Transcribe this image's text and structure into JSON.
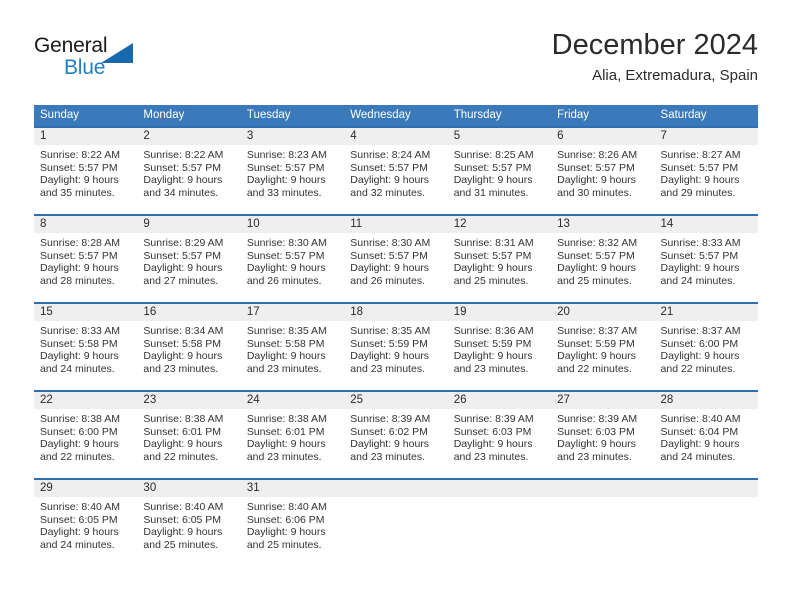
{
  "brand": {
    "name_part1": "General",
    "name_part2": "Blue",
    "triangle_icon": "triangle-icon",
    "accent_color": "#1f7fc4"
  },
  "header": {
    "title": "December 2024",
    "subtitle": "Alia, Extremadura, Spain"
  },
  "colors": {
    "header_blue": "#3a79ba",
    "row_divider_blue": "#2f6eb0",
    "daynum_band": "#efefef",
    "text": "#2b2b2b"
  },
  "calendar": {
    "weekday_headers": [
      "Sunday",
      "Monday",
      "Tuesday",
      "Wednesday",
      "Thursday",
      "Friday",
      "Saturday"
    ],
    "labels": {
      "sunrise_prefix": "Sunrise:",
      "sunset_prefix": "Sunset:",
      "daylight_prefix": "Daylight:"
    },
    "weeks": [
      [
        {
          "day": "1",
          "sunrise": "Sunrise: 8:22 AM",
          "sunset": "Sunset: 5:57 PM",
          "daylight_1": "Daylight: 9 hours",
          "daylight_2": "and 35 minutes."
        },
        {
          "day": "2",
          "sunrise": "Sunrise: 8:22 AM",
          "sunset": "Sunset: 5:57 PM",
          "daylight_1": "Daylight: 9 hours",
          "daylight_2": "and 34 minutes."
        },
        {
          "day": "3",
          "sunrise": "Sunrise: 8:23 AM",
          "sunset": "Sunset: 5:57 PM",
          "daylight_1": "Daylight: 9 hours",
          "daylight_2": "and 33 minutes."
        },
        {
          "day": "4",
          "sunrise": "Sunrise: 8:24 AM",
          "sunset": "Sunset: 5:57 PM",
          "daylight_1": "Daylight: 9 hours",
          "daylight_2": "and 32 minutes."
        },
        {
          "day": "5",
          "sunrise": "Sunrise: 8:25 AM",
          "sunset": "Sunset: 5:57 PM",
          "daylight_1": "Daylight: 9 hours",
          "daylight_2": "and 31 minutes."
        },
        {
          "day": "6",
          "sunrise": "Sunrise: 8:26 AM",
          "sunset": "Sunset: 5:57 PM",
          "daylight_1": "Daylight: 9 hours",
          "daylight_2": "and 30 minutes."
        },
        {
          "day": "7",
          "sunrise": "Sunrise: 8:27 AM",
          "sunset": "Sunset: 5:57 PM",
          "daylight_1": "Daylight: 9 hours",
          "daylight_2": "and 29 minutes."
        }
      ],
      [
        {
          "day": "8",
          "sunrise": "Sunrise: 8:28 AM",
          "sunset": "Sunset: 5:57 PM",
          "daylight_1": "Daylight: 9 hours",
          "daylight_2": "and 28 minutes."
        },
        {
          "day": "9",
          "sunrise": "Sunrise: 8:29 AM",
          "sunset": "Sunset: 5:57 PM",
          "daylight_1": "Daylight: 9 hours",
          "daylight_2": "and 27 minutes."
        },
        {
          "day": "10",
          "sunrise": "Sunrise: 8:30 AM",
          "sunset": "Sunset: 5:57 PM",
          "daylight_1": "Daylight: 9 hours",
          "daylight_2": "and 26 minutes."
        },
        {
          "day": "11",
          "sunrise": "Sunrise: 8:30 AM",
          "sunset": "Sunset: 5:57 PM",
          "daylight_1": "Daylight: 9 hours",
          "daylight_2": "and 26 minutes."
        },
        {
          "day": "12",
          "sunrise": "Sunrise: 8:31 AM",
          "sunset": "Sunset: 5:57 PM",
          "daylight_1": "Daylight: 9 hours",
          "daylight_2": "and 25 minutes."
        },
        {
          "day": "13",
          "sunrise": "Sunrise: 8:32 AM",
          "sunset": "Sunset: 5:57 PM",
          "daylight_1": "Daylight: 9 hours",
          "daylight_2": "and 25 minutes."
        },
        {
          "day": "14",
          "sunrise": "Sunrise: 8:33 AM",
          "sunset": "Sunset: 5:57 PM",
          "daylight_1": "Daylight: 9 hours",
          "daylight_2": "and 24 minutes."
        }
      ],
      [
        {
          "day": "15",
          "sunrise": "Sunrise: 8:33 AM",
          "sunset": "Sunset: 5:58 PM",
          "daylight_1": "Daylight: 9 hours",
          "daylight_2": "and 24 minutes."
        },
        {
          "day": "16",
          "sunrise": "Sunrise: 8:34 AM",
          "sunset": "Sunset: 5:58 PM",
          "daylight_1": "Daylight: 9 hours",
          "daylight_2": "and 23 minutes."
        },
        {
          "day": "17",
          "sunrise": "Sunrise: 8:35 AM",
          "sunset": "Sunset: 5:58 PM",
          "daylight_1": "Daylight: 9 hours",
          "daylight_2": "and 23 minutes."
        },
        {
          "day": "18",
          "sunrise": "Sunrise: 8:35 AM",
          "sunset": "Sunset: 5:59 PM",
          "daylight_1": "Daylight: 9 hours",
          "daylight_2": "and 23 minutes."
        },
        {
          "day": "19",
          "sunrise": "Sunrise: 8:36 AM",
          "sunset": "Sunset: 5:59 PM",
          "daylight_1": "Daylight: 9 hours",
          "daylight_2": "and 23 minutes."
        },
        {
          "day": "20",
          "sunrise": "Sunrise: 8:37 AM",
          "sunset": "Sunset: 5:59 PM",
          "daylight_1": "Daylight: 9 hours",
          "daylight_2": "and 22 minutes."
        },
        {
          "day": "21",
          "sunrise": "Sunrise: 8:37 AM",
          "sunset": "Sunset: 6:00 PM",
          "daylight_1": "Daylight: 9 hours",
          "daylight_2": "and 22 minutes."
        }
      ],
      [
        {
          "day": "22",
          "sunrise": "Sunrise: 8:38 AM",
          "sunset": "Sunset: 6:00 PM",
          "daylight_1": "Daylight: 9 hours",
          "daylight_2": "and 22 minutes."
        },
        {
          "day": "23",
          "sunrise": "Sunrise: 8:38 AM",
          "sunset": "Sunset: 6:01 PM",
          "daylight_1": "Daylight: 9 hours",
          "daylight_2": "and 22 minutes."
        },
        {
          "day": "24",
          "sunrise": "Sunrise: 8:38 AM",
          "sunset": "Sunset: 6:01 PM",
          "daylight_1": "Daylight: 9 hours",
          "daylight_2": "and 23 minutes."
        },
        {
          "day": "25",
          "sunrise": "Sunrise: 8:39 AM",
          "sunset": "Sunset: 6:02 PM",
          "daylight_1": "Daylight: 9 hours",
          "daylight_2": "and 23 minutes."
        },
        {
          "day": "26",
          "sunrise": "Sunrise: 8:39 AM",
          "sunset": "Sunset: 6:03 PM",
          "daylight_1": "Daylight: 9 hours",
          "daylight_2": "and 23 minutes."
        },
        {
          "day": "27",
          "sunrise": "Sunrise: 8:39 AM",
          "sunset": "Sunset: 6:03 PM",
          "daylight_1": "Daylight: 9 hours",
          "daylight_2": "and 23 minutes."
        },
        {
          "day": "28",
          "sunrise": "Sunrise: 8:40 AM",
          "sunset": "Sunset: 6:04 PM",
          "daylight_1": "Daylight: 9 hours",
          "daylight_2": "and 24 minutes."
        }
      ],
      [
        {
          "day": "29",
          "sunrise": "Sunrise: 8:40 AM",
          "sunset": "Sunset: 6:05 PM",
          "daylight_1": "Daylight: 9 hours",
          "daylight_2": "and 24 minutes."
        },
        {
          "day": "30",
          "sunrise": "Sunrise: 8:40 AM",
          "sunset": "Sunset: 6:05 PM",
          "daylight_1": "Daylight: 9 hours",
          "daylight_2": "and 25 minutes."
        },
        {
          "day": "31",
          "sunrise": "Sunrise: 8:40 AM",
          "sunset": "Sunset: 6:06 PM",
          "daylight_1": "Daylight: 9 hours",
          "daylight_2": "and 25 minutes."
        },
        {
          "day": "",
          "sunrise": "",
          "sunset": "",
          "daylight_1": "",
          "daylight_2": ""
        },
        {
          "day": "",
          "sunrise": "",
          "sunset": "",
          "daylight_1": "",
          "daylight_2": ""
        },
        {
          "day": "",
          "sunrise": "",
          "sunset": "",
          "daylight_1": "",
          "daylight_2": ""
        },
        {
          "day": "",
          "sunrise": "",
          "sunset": "",
          "daylight_1": "",
          "daylight_2": ""
        }
      ]
    ]
  }
}
